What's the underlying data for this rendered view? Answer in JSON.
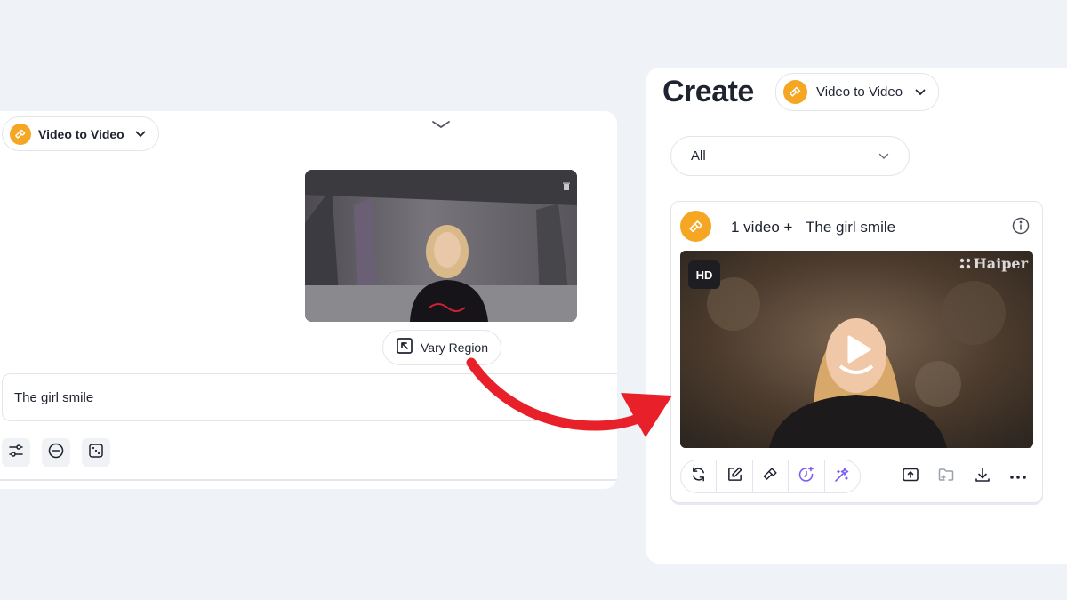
{
  "left_panel": {
    "mode_selector": {
      "label": "Video to Video"
    },
    "vary_region_button": {
      "label": "Vary Region"
    },
    "prompt": {
      "value": "The girl smile"
    }
  },
  "right_panel": {
    "title": "Create",
    "mode_selector": {
      "label": "Video to Video"
    },
    "filter": {
      "selected": "All"
    },
    "result_card": {
      "count_label": "1 video +",
      "prompt": "The girl smile",
      "badge": "HD",
      "watermark": "Haiper"
    }
  },
  "colors": {
    "accent_orange": "#f5a623",
    "ai_purple": "#7c5cf5",
    "arrow_red": "#e8202a"
  }
}
